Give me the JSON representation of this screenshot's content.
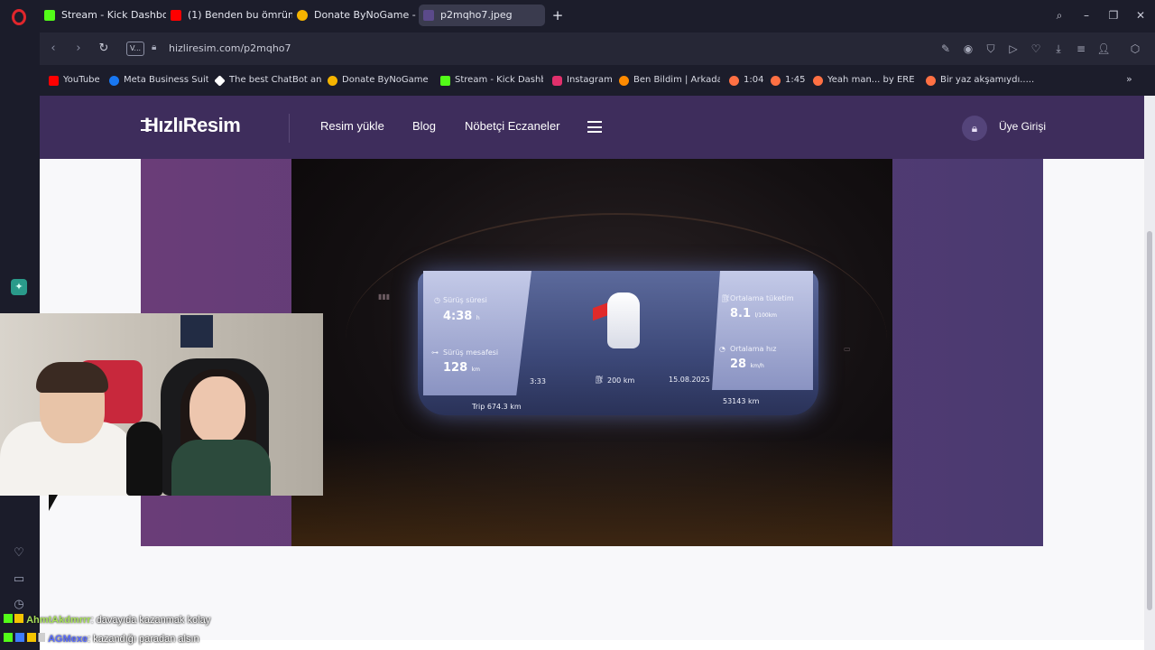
{
  "tabs": [
    {
      "label": "Stream - Kick Dashboard",
      "fav_color": "#53fc18"
    },
    {
      "label": "(1) Benden bu ömrümü ç",
      "fav_color": "#ff0000"
    },
    {
      "label": "Donate ByNoGame - Gele",
      "fav_color": "#f5b400"
    },
    {
      "label": "p2mqho7.jpeg",
      "fav_color": "#5b4a8a",
      "active": true
    }
  ],
  "address": {
    "url": "hizliresim.com/p2mqho7",
    "vpn": "V..."
  },
  "bookmarks": [
    {
      "label": "YouTube",
      "fav_color": "#ff0000"
    },
    {
      "label": "Meta Business Suite",
      "fav_color": "#1877f2"
    },
    {
      "label": "The best ChatBot an...",
      "fav_color": "#ffffff"
    },
    {
      "label": "Donate ByNoGame...",
      "fav_color": "#f5b400"
    },
    {
      "label": "Stream - Kick Dashb...",
      "fav_color": "#53fc18"
    },
    {
      "label": "Instagram",
      "fav_color": "#e1306c"
    },
    {
      "label": "Ben Bildim | Arkada...",
      "fav_color": "#ff8a00"
    },
    {
      "label": "1:04",
      "fav_color": "#ff7043"
    },
    {
      "label": "1:45",
      "fav_color": "#ff7043"
    },
    {
      "label": "Yeah man... by ERE...",
      "fav_color": "#ff7043"
    },
    {
      "label": "Bir yaz akşamıydı......",
      "fav_color": "#ff7043"
    }
  ],
  "site": {
    "logo": "HızlıResim",
    "nav": [
      "Resim yükle",
      "Blog",
      "Nöbetçi Eczaneler"
    ],
    "login": "Üye Girişi"
  },
  "cluster": {
    "left_top_label": "Sürüş süresi",
    "left_top_value": "4:38",
    "left_top_unit": "h",
    "left_bottom_label": "Sürüş mesafesi",
    "left_bottom_value": "128",
    "left_bottom_unit": "km",
    "right_top_label": "Ortalama tüketim",
    "right_top_value": "8.1",
    "right_top_unit": "l/100km",
    "right_bottom_label": "Ortalama hız",
    "right_bottom_value": "28",
    "right_bottom_unit": "km/h",
    "time": "3:33",
    "range": "200 km",
    "date": "15.08.2025",
    "trip": "Trip 674.3 km",
    "odometer": "53143 km"
  },
  "chat": [
    {
      "user": "AhmtAkdmrrr",
      "message": ": davayıda kazanmak kolay",
      "user_color": "#a8e05a"
    },
    {
      "user": "AGMexe",
      "message": ": kazandığı paradan alsın",
      "user_color": "#5a6cff"
    }
  ]
}
